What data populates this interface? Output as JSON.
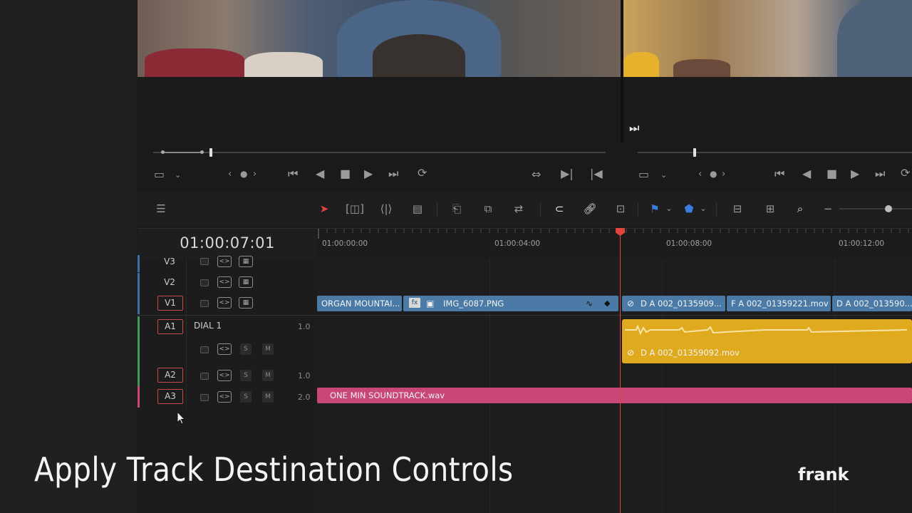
{
  "timeline": {
    "timecode": "01:00:07:01",
    "ruler_labels": [
      "01:00:00:00",
      "01:00:04:00",
      "01:00:08:00",
      "01:00:12:00"
    ]
  },
  "tracks": [
    {
      "id": "V3",
      "label": "V3",
      "type": "video",
      "selected": false
    },
    {
      "id": "V2",
      "label": "V2",
      "type": "video",
      "selected": false
    },
    {
      "id": "V1",
      "label": "V1",
      "type": "video",
      "selected": true
    },
    {
      "id": "A1",
      "label": "A1",
      "type": "audio",
      "name": "DIAL 1",
      "volume": "1.0",
      "selected": true
    },
    {
      "id": "A2",
      "label": "A2",
      "type": "audio",
      "name": "",
      "volume": "1.0",
      "selected": true
    },
    {
      "id": "A3",
      "label": "A3",
      "type": "audio",
      "name": "",
      "volume": "2.0",
      "selected": true
    }
  ],
  "audio_buttons": {
    "solo": "S",
    "mute": "M"
  },
  "clips": {
    "organ": "ORGAN MOUNTAI...",
    "img": "IMG_6087.PNG",
    "da1": "D A 002_0135909...",
    "fa": "F A 002_01359221.mov",
    "da2": "D A 002_013590...",
    "da_audio": "D A 002_01359092.mov",
    "soundtrack": "ONE MIN SOUNDTRACK.wav"
  },
  "caption": "Apply Track Destination Controls",
  "brand": "frank",
  "colors": {
    "video_clip": "#4a7aa5",
    "audio_clip": "#e0aa1f",
    "music_clip": "#c84777",
    "playhead": "#e0463f",
    "track_select": "#c94a4a"
  }
}
